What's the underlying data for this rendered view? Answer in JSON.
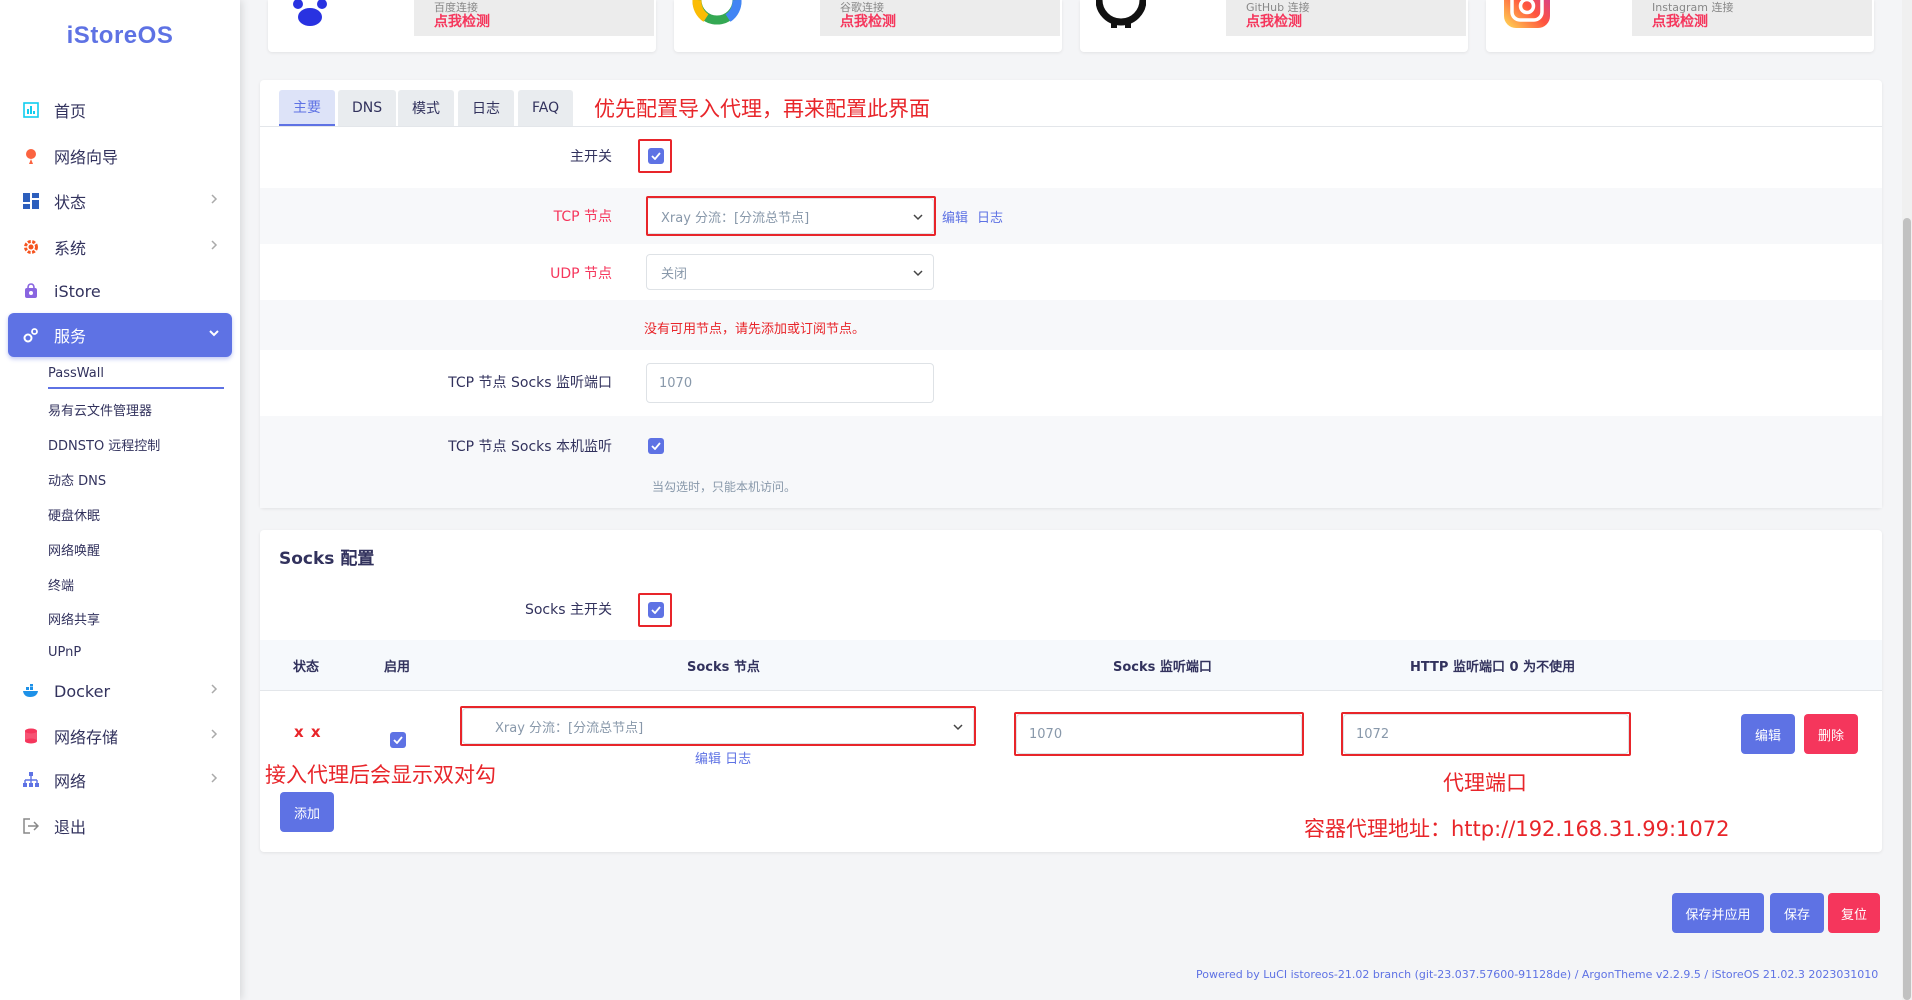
{
  "app": {
    "logo": "iStoreOS"
  },
  "sidebar": {
    "items": [
      {
        "label": "首页",
        "icon": "dashboard-icon"
      },
      {
        "label": "网络向导",
        "icon": "wizard-icon"
      },
      {
        "label": "状态",
        "icon": "status-icon"
      },
      {
        "label": "系统",
        "icon": "gear-icon"
      },
      {
        "label": "iStore",
        "icon": "store-icon"
      },
      {
        "label": "服务",
        "icon": "services-icon"
      },
      {
        "label": "Docker",
        "icon": "docker-icon"
      },
      {
        "label": "网络存储",
        "icon": "storage-icon"
      },
      {
        "label": "网络",
        "icon": "network-icon"
      },
      {
        "label": "退出",
        "icon": "logout-icon"
      }
    ],
    "sub_items": [
      "PassWall",
      "易有云文件管理器",
      "DDNSTO 远程控制",
      "动态 DNS",
      "硬盘休眠",
      "网络唤醒",
      "终端",
      "网络共享",
      "UPnP"
    ]
  },
  "connections": [
    {
      "name": "百度连接",
      "check": "点我检测",
      "icon": "baidu-icon"
    },
    {
      "name": "谷歌连接",
      "check": "点我检测",
      "icon": "google-icon"
    },
    {
      "name": "GitHub 连接",
      "check": "点我检测",
      "icon": "github-icon"
    },
    {
      "name": "Instagram 连接",
      "check": "点我检测",
      "icon": "instagram-icon"
    }
  ],
  "tabs": [
    "主要",
    "DNS",
    "模式",
    "日志",
    "FAQ"
  ],
  "main": {
    "switch_label": "主开关",
    "tcp_label": "TCP 节点",
    "tcp_value": "Xray 分流：[分流总节点]",
    "edit_link": "编辑",
    "log_link": "日志",
    "udp_label": "UDP 节点",
    "udp_value": "关闭",
    "no_node_msg": "没有可用节点，请先添加或订阅节点。",
    "socks_port_label": "TCP 节点 Socks 监听端口",
    "socks_port_value": "1070",
    "socks_local_label": "TCP 节点 Socks 本机监听",
    "socks_local_hint": "当勾选时，只能本机访问。"
  },
  "socks": {
    "title": "Socks 配置",
    "switch_label": "Socks 主开关",
    "headers": [
      "状态",
      "启用",
      "Socks 节点",
      "Socks 监听端口",
      "HTTP 监听端口 0 为不使用"
    ],
    "row": {
      "status": "x x",
      "node": "Xray 分流：[分流总节点]",
      "node_links": "编辑 日志",
      "socks_port": "1070",
      "http_port": "1072",
      "edit_btn": "编辑",
      "delete_btn": "删除"
    },
    "add_btn": "添加"
  },
  "footer_buttons": {
    "save_apply": "保存并应用",
    "save": "保存",
    "reset": "复位"
  },
  "footer_text": "Powered by LuCI istoreos-21.02 branch (git-23.037.57600-91128de) / ArgonTheme v2.2.9.5 / iStoreOS 21.02.3 2023031010",
  "annotations": {
    "top": "优先配置导入代理，再来配置此界面",
    "double_check": "接入代理后会显示双对勾",
    "proxy_port": "代理端口",
    "container_addr": "容器代理地址：http://192.168.31.99:1072"
  },
  "colors": {
    "accent": "#5e72e4",
    "danger": "#f5365c",
    "annotation": "#e8252a"
  }
}
